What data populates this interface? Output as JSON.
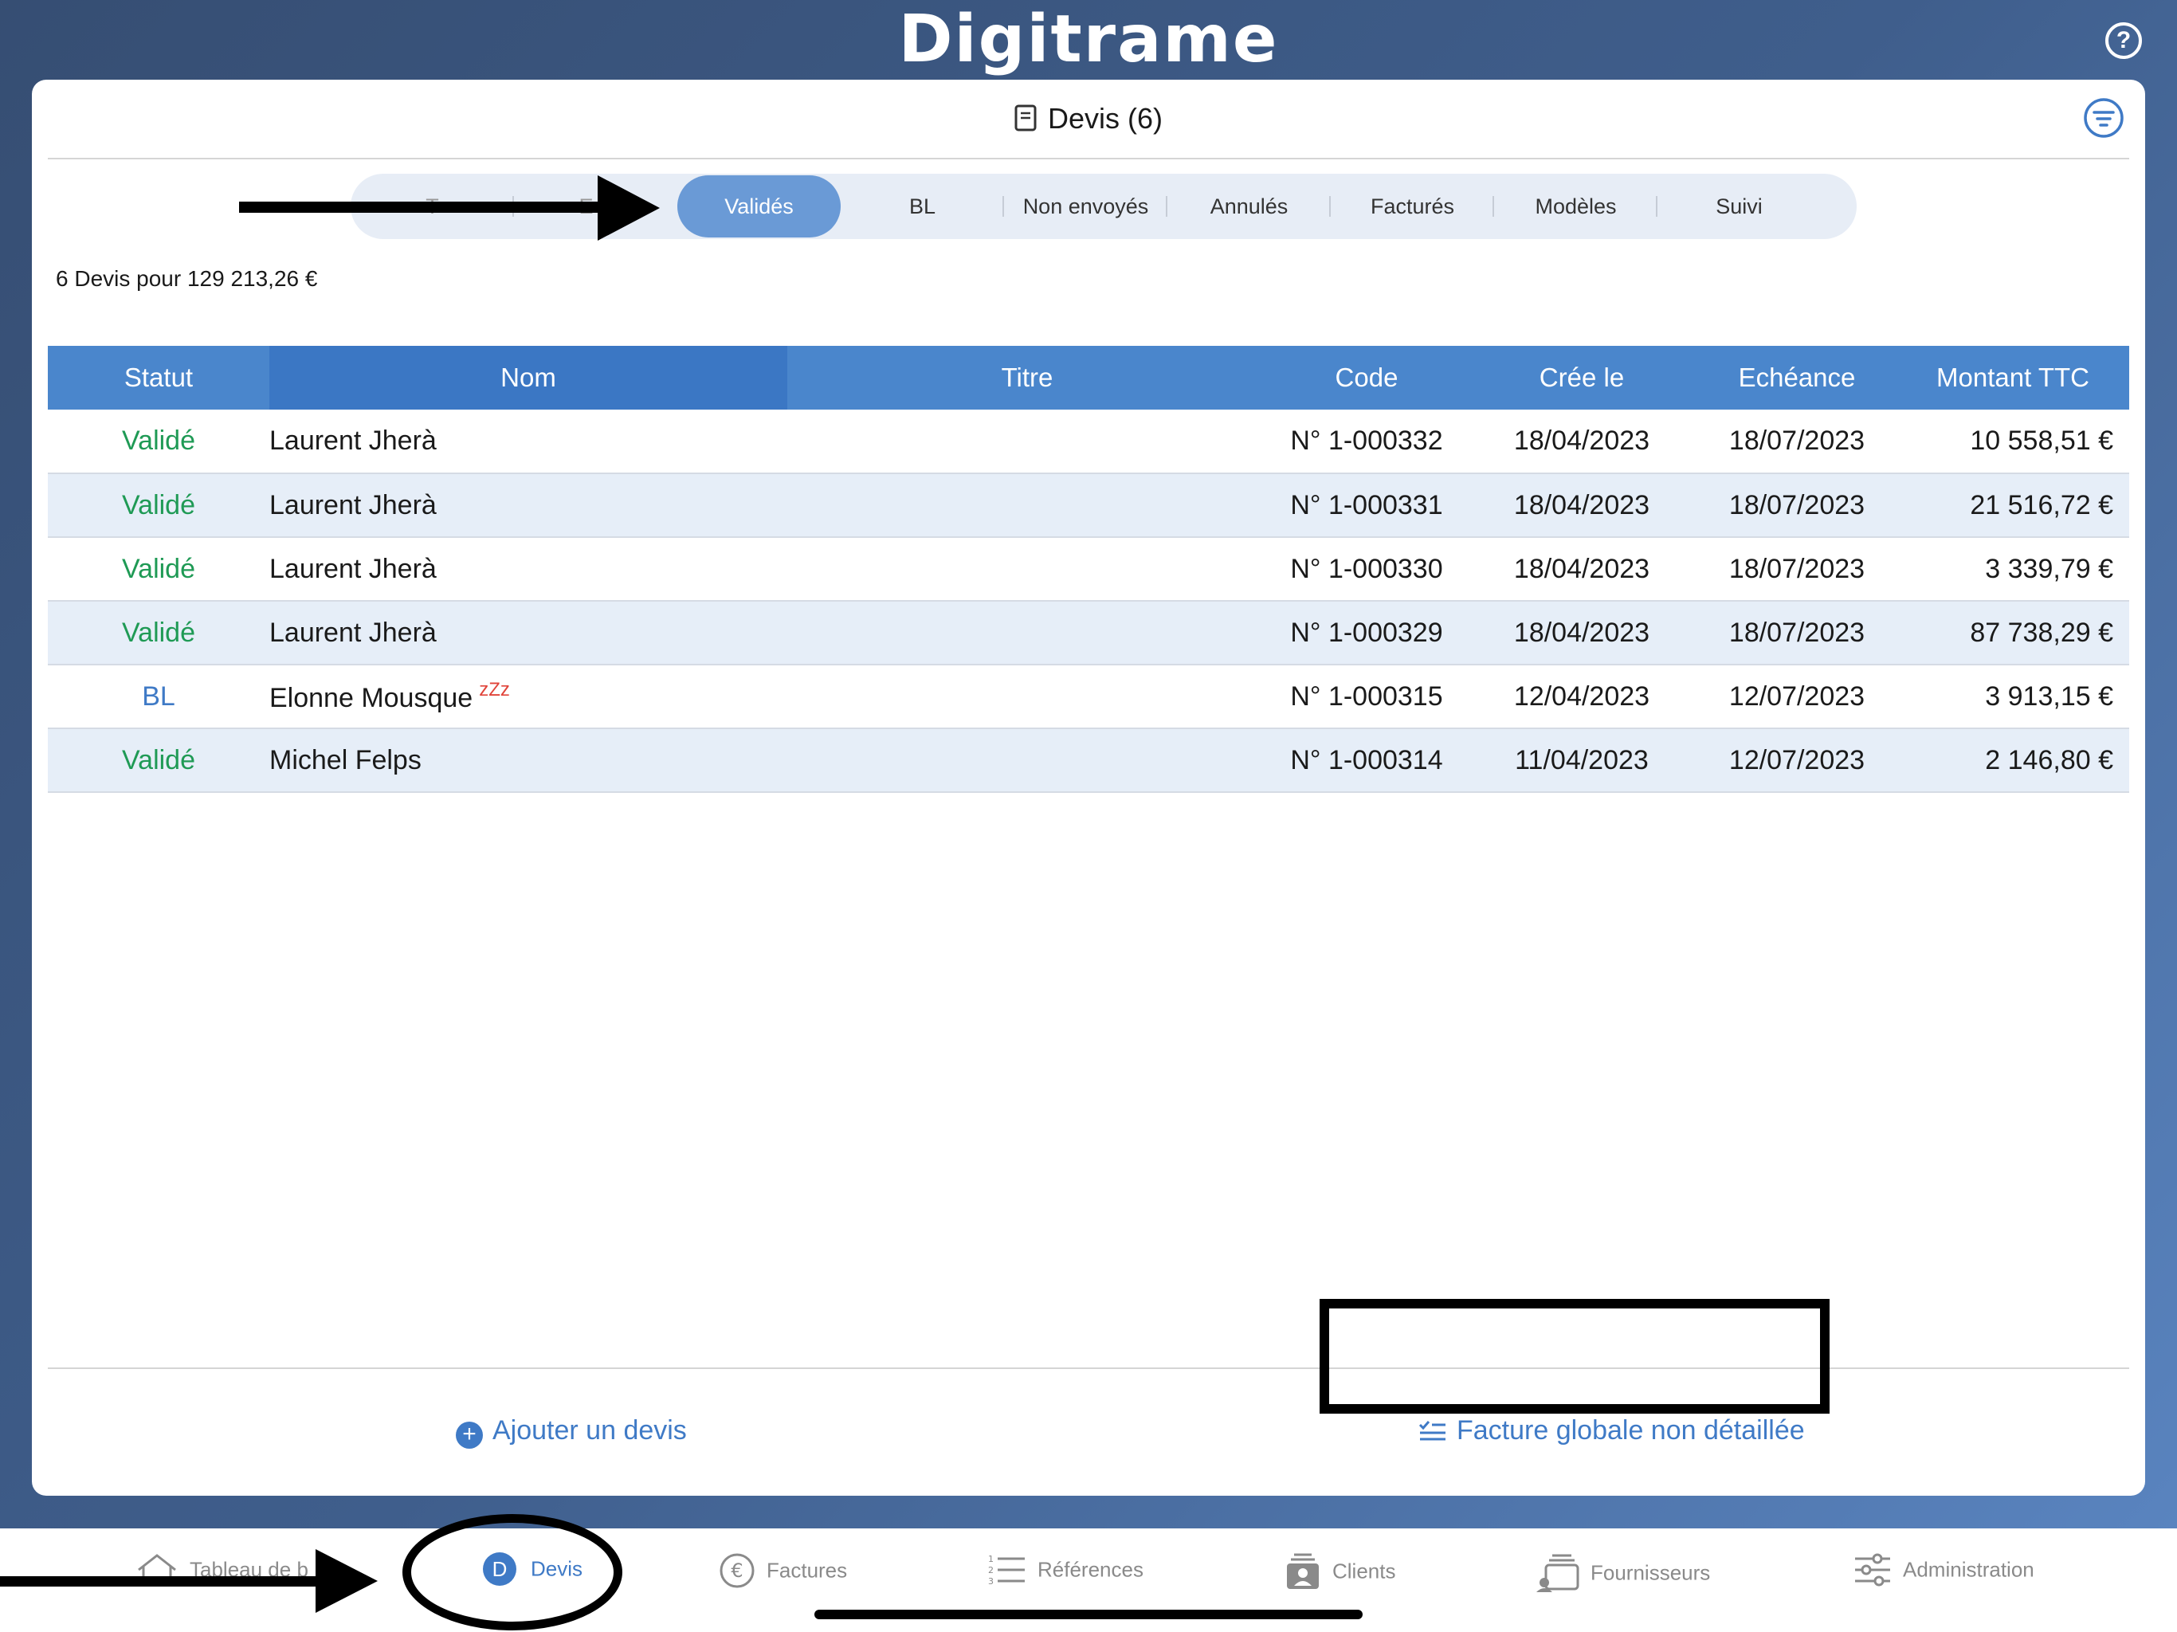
{
  "app": {
    "logo": "Digitrame",
    "help_icon": "question-circle-icon"
  },
  "header": {
    "title": "Devis (6)",
    "doc_icon": "document-icon",
    "filter_icon": "filter-icon"
  },
  "segments": {
    "active_index": 2,
    "items": [
      "T",
      "E A",
      "Validés",
      "BL",
      "Non envoyés",
      "Annulés",
      "Facturés",
      "Modèles",
      "Suivi"
    ]
  },
  "summary": "6 Devis pour 129 213,26 €",
  "table": {
    "columns": [
      "Statut",
      "Nom",
      "Titre",
      "Code",
      "Crée le",
      "Echéance",
      "Montant TTC"
    ],
    "rows": [
      {
        "statut": "Validé",
        "nom": "Laurent Jherà",
        "titre": "",
        "code": "N° 1-000332",
        "cree": "18/04/2023",
        "echeance": "18/07/2023",
        "montant": "10 558,51 €"
      },
      {
        "statut": "Validé",
        "nom": "Laurent Jherà",
        "titre": "",
        "code": "N° 1-000331",
        "cree": "18/04/2023",
        "echeance": "18/07/2023",
        "montant": "21 516,72 €"
      },
      {
        "statut": "Validé",
        "nom": "Laurent Jherà",
        "titre": "",
        "code": "N° 1-000330",
        "cree": "18/04/2023",
        "echeance": "18/07/2023",
        "montant": "3 339,79 €"
      },
      {
        "statut": "Validé",
        "nom": "Laurent Jherà",
        "titre": "",
        "code": "N° 1-000329",
        "cree": "18/04/2023",
        "echeance": "18/07/2023",
        "montant": "87 738,29 €"
      },
      {
        "statut": "BL",
        "nom": "Elonne Mousque",
        "badge": "zZz",
        "titre": "",
        "code": "N° 1-000315",
        "cree": "12/04/2023",
        "echeance": "12/07/2023",
        "montant": "3 913,15 €"
      },
      {
        "statut": "Validé",
        "nom": "Michel Felps",
        "titre": "",
        "code": "N° 1-000314",
        "cree": "11/04/2023",
        "echeance": "12/07/2023",
        "montant": "2 146,80 €"
      }
    ]
  },
  "actions": {
    "add": "Ajouter un devis",
    "invoice": "Facture globale non détaillée"
  },
  "tabbar": {
    "items": [
      {
        "label": "Tableau de b",
        "icon": "home-icon"
      },
      {
        "label": "Devis",
        "icon": "d-circle-icon",
        "glyph": "D",
        "active": true
      },
      {
        "label": "Factures",
        "icon": "euro-icon"
      },
      {
        "label": "Références",
        "icon": "numbered-list-icon"
      },
      {
        "label": "Clients",
        "icon": "contact-card-icon"
      },
      {
        "label": "Fournisseurs",
        "icon": "supplier-icon"
      },
      {
        "label": "Administration",
        "icon": "sliders-icon"
      }
    ]
  },
  "colors": {
    "accent": "#3f7ac6",
    "valide": "#1f9a55",
    "header_bg": "#4a86cc",
    "alt_row": "#e6eef8",
    "zzz": "#e0443a"
  }
}
